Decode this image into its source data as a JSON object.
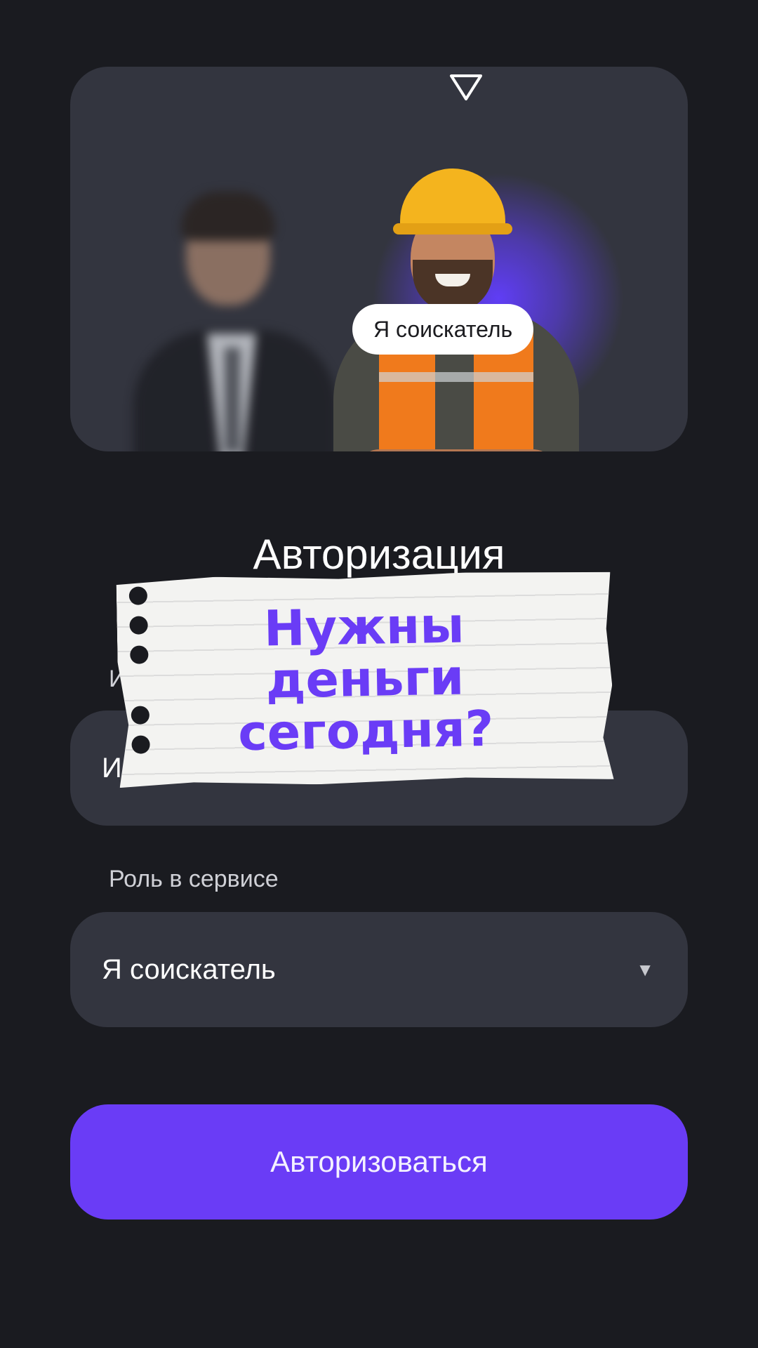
{
  "hero": {
    "badge_label": "Я соискатель"
  },
  "form": {
    "title": "Авторизация",
    "name_label": "Им",
    "name_value": "Иван",
    "role_label": "Роль в сервисе",
    "role_value": "Я соискатель",
    "submit_label": "Авторизоваться"
  },
  "overlay": {
    "note_lines": [
      "Нужны",
      "деньги",
      "сегодня?"
    ]
  },
  "colors": {
    "accent": "#6a3cf6",
    "background": "#1a1b20",
    "surface": "#33353f"
  }
}
